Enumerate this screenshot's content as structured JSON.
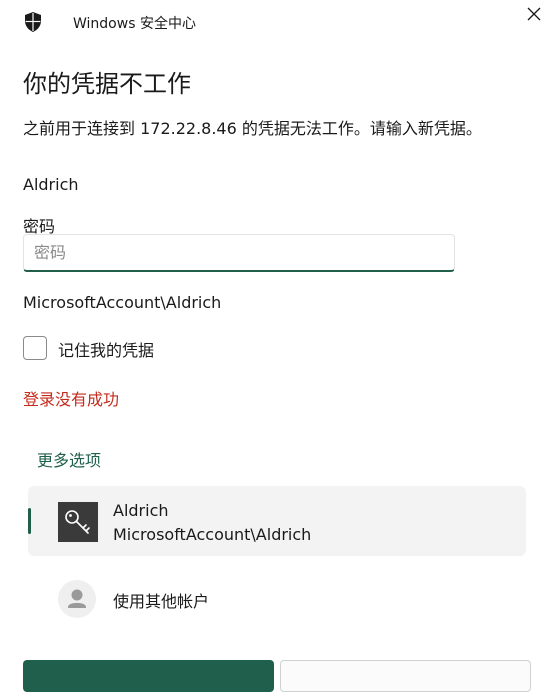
{
  "window": {
    "title": "Windows 安全中心",
    "icon": "shield-icon",
    "close_icon": "close-icon"
  },
  "dialog": {
    "heading": "你的凭据不工作",
    "description": "之前用于连接到 172.22.8.46 的凭据无法工作。请输入新凭据。",
    "username": "Aldrich",
    "password_label": "密码",
    "password_value": "",
    "password_placeholder": "密码",
    "account_domain": "MicrosoftAccount\\Aldrich",
    "remember_label": "记住我的凭据",
    "remember_checked": false,
    "error_message": "登录没有成功",
    "more_options": "更多选项"
  },
  "credentials": [
    {
      "name": "Aldrich",
      "account": "MicrosoftAccount\\Aldrich",
      "icon": "key-icon",
      "selected": true
    },
    {
      "name": "使用其他帐户",
      "icon": "user-icon",
      "selected": false
    }
  ],
  "colors": {
    "accent": "#1f5f4b",
    "error": "#c42b1c",
    "selected_bg": "#f3f3f3"
  }
}
